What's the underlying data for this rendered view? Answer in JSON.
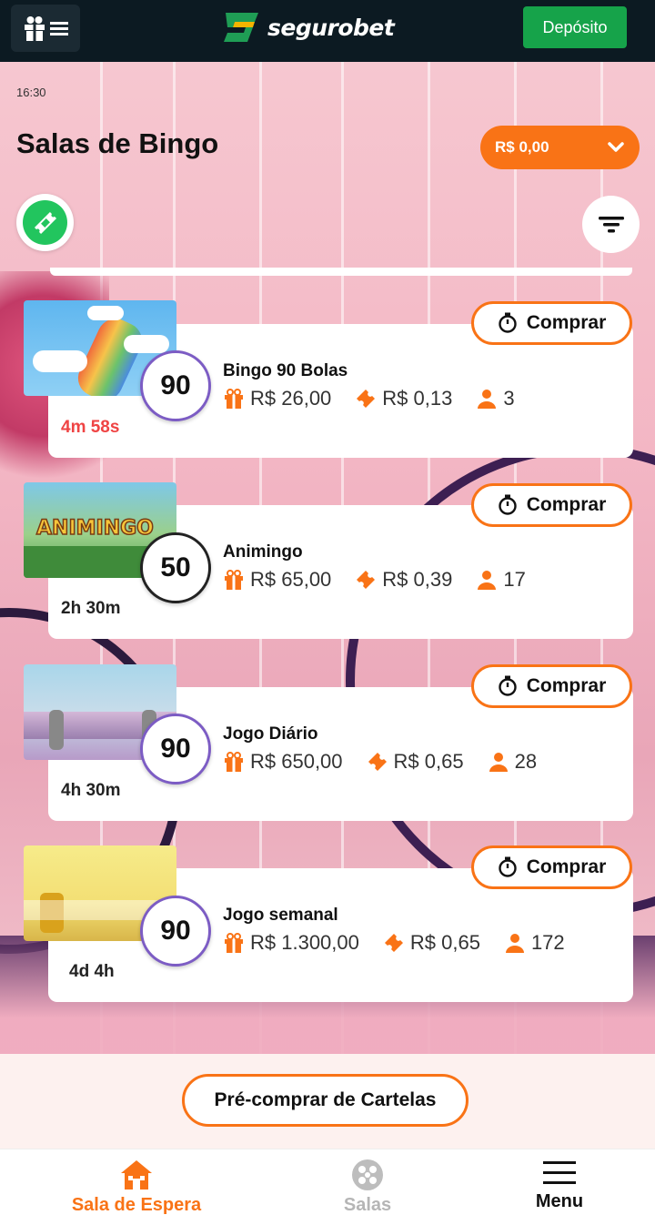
{
  "header": {
    "logo_text": "segurobet",
    "deposit_label": "Depósito"
  },
  "status": {
    "time": "16:30"
  },
  "page": {
    "title": "Salas de Bingo",
    "balance": "R$ 0,00"
  },
  "buy_label": "Comprar",
  "rooms": [
    {
      "ball": "90",
      "name": "Bingo 90 Bolas",
      "prize": "R$ 26,00",
      "card_price": "R$ 0,13",
      "players": "3",
      "timer": "4m 58s"
    },
    {
      "ball": "50",
      "name": "Animingo",
      "prize": "R$ 65,00",
      "card_price": "R$ 0,39",
      "players": "17",
      "timer": "2h 30m",
      "thumb_text": "ANIMINGO"
    },
    {
      "ball": "90",
      "name": "Jogo Diário",
      "prize": "R$ 650,00",
      "card_price": "R$ 0,65",
      "players": "28",
      "timer": "4h 30m"
    },
    {
      "ball": "90",
      "name": "Jogo semanal",
      "prize": "R$ 1.300,00",
      "card_price": "R$ 0,65",
      "players": "172",
      "timer": "4d 4h"
    }
  ],
  "precompra_label": "Pré-comprar de Cartelas",
  "nav": [
    {
      "label": "Sala de Espera",
      "icon": "house-icon",
      "active": true
    },
    {
      "label": "Salas",
      "icon": "bingo-balls-icon",
      "active": false
    },
    {
      "label": "Menu",
      "icon": "hamburger-icon",
      "active": false
    }
  ],
  "colors": {
    "accent": "#f97316",
    "deposit_green": "#16a34a",
    "header_bg": "#0c1a22",
    "timer_red": "#ef4444"
  }
}
